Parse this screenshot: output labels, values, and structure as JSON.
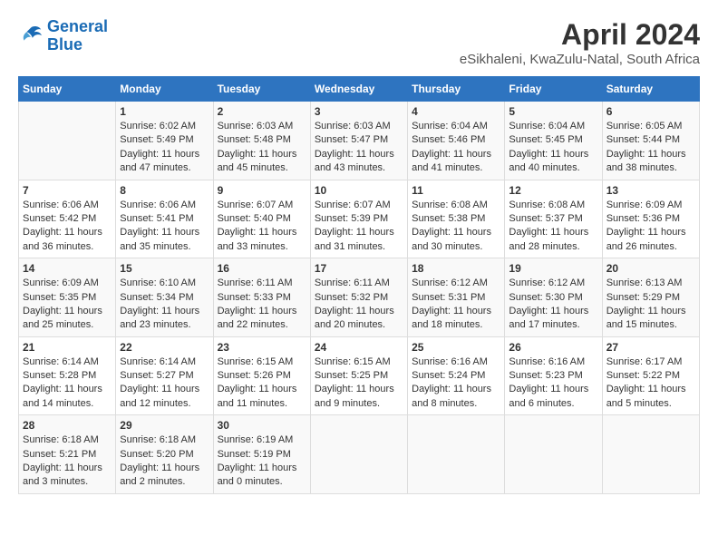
{
  "header": {
    "logo_line1": "General",
    "logo_line2": "Blue",
    "title": "April 2024",
    "subtitle": "eSikhaleni, KwaZulu-Natal, South Africa"
  },
  "columns": [
    "Sunday",
    "Monday",
    "Tuesday",
    "Wednesday",
    "Thursday",
    "Friday",
    "Saturday"
  ],
  "weeks": [
    [
      {
        "day": "",
        "lines": []
      },
      {
        "day": "1",
        "lines": [
          "Sunrise: 6:02 AM",
          "Sunset: 5:49 PM",
          "Daylight: 11 hours",
          "and 47 minutes."
        ]
      },
      {
        "day": "2",
        "lines": [
          "Sunrise: 6:03 AM",
          "Sunset: 5:48 PM",
          "Daylight: 11 hours",
          "and 45 minutes."
        ]
      },
      {
        "day": "3",
        "lines": [
          "Sunrise: 6:03 AM",
          "Sunset: 5:47 PM",
          "Daylight: 11 hours",
          "and 43 minutes."
        ]
      },
      {
        "day": "4",
        "lines": [
          "Sunrise: 6:04 AM",
          "Sunset: 5:46 PM",
          "Daylight: 11 hours",
          "and 41 minutes."
        ]
      },
      {
        "day": "5",
        "lines": [
          "Sunrise: 6:04 AM",
          "Sunset: 5:45 PM",
          "Daylight: 11 hours",
          "and 40 minutes."
        ]
      },
      {
        "day": "6",
        "lines": [
          "Sunrise: 6:05 AM",
          "Sunset: 5:44 PM",
          "Daylight: 11 hours",
          "and 38 minutes."
        ]
      }
    ],
    [
      {
        "day": "7",
        "lines": [
          "Sunrise: 6:06 AM",
          "Sunset: 5:42 PM",
          "Daylight: 11 hours",
          "and 36 minutes."
        ]
      },
      {
        "day": "8",
        "lines": [
          "Sunrise: 6:06 AM",
          "Sunset: 5:41 PM",
          "Daylight: 11 hours",
          "and 35 minutes."
        ]
      },
      {
        "day": "9",
        "lines": [
          "Sunrise: 6:07 AM",
          "Sunset: 5:40 PM",
          "Daylight: 11 hours",
          "and 33 minutes."
        ]
      },
      {
        "day": "10",
        "lines": [
          "Sunrise: 6:07 AM",
          "Sunset: 5:39 PM",
          "Daylight: 11 hours",
          "and 31 minutes."
        ]
      },
      {
        "day": "11",
        "lines": [
          "Sunrise: 6:08 AM",
          "Sunset: 5:38 PM",
          "Daylight: 11 hours",
          "and 30 minutes."
        ]
      },
      {
        "day": "12",
        "lines": [
          "Sunrise: 6:08 AM",
          "Sunset: 5:37 PM",
          "Daylight: 11 hours",
          "and 28 minutes."
        ]
      },
      {
        "day": "13",
        "lines": [
          "Sunrise: 6:09 AM",
          "Sunset: 5:36 PM",
          "Daylight: 11 hours",
          "and 26 minutes."
        ]
      }
    ],
    [
      {
        "day": "14",
        "lines": [
          "Sunrise: 6:09 AM",
          "Sunset: 5:35 PM",
          "Daylight: 11 hours",
          "and 25 minutes."
        ]
      },
      {
        "day": "15",
        "lines": [
          "Sunrise: 6:10 AM",
          "Sunset: 5:34 PM",
          "Daylight: 11 hours",
          "and 23 minutes."
        ]
      },
      {
        "day": "16",
        "lines": [
          "Sunrise: 6:11 AM",
          "Sunset: 5:33 PM",
          "Daylight: 11 hours",
          "and 22 minutes."
        ]
      },
      {
        "day": "17",
        "lines": [
          "Sunrise: 6:11 AM",
          "Sunset: 5:32 PM",
          "Daylight: 11 hours",
          "and 20 minutes."
        ]
      },
      {
        "day": "18",
        "lines": [
          "Sunrise: 6:12 AM",
          "Sunset: 5:31 PM",
          "Daylight: 11 hours",
          "and 18 minutes."
        ]
      },
      {
        "day": "19",
        "lines": [
          "Sunrise: 6:12 AM",
          "Sunset: 5:30 PM",
          "Daylight: 11 hours",
          "and 17 minutes."
        ]
      },
      {
        "day": "20",
        "lines": [
          "Sunrise: 6:13 AM",
          "Sunset: 5:29 PM",
          "Daylight: 11 hours",
          "and 15 minutes."
        ]
      }
    ],
    [
      {
        "day": "21",
        "lines": [
          "Sunrise: 6:14 AM",
          "Sunset: 5:28 PM",
          "Daylight: 11 hours",
          "and 14 minutes."
        ]
      },
      {
        "day": "22",
        "lines": [
          "Sunrise: 6:14 AM",
          "Sunset: 5:27 PM",
          "Daylight: 11 hours",
          "and 12 minutes."
        ]
      },
      {
        "day": "23",
        "lines": [
          "Sunrise: 6:15 AM",
          "Sunset: 5:26 PM",
          "Daylight: 11 hours",
          "and 11 minutes."
        ]
      },
      {
        "day": "24",
        "lines": [
          "Sunrise: 6:15 AM",
          "Sunset: 5:25 PM",
          "Daylight: 11 hours",
          "and 9 minutes."
        ]
      },
      {
        "day": "25",
        "lines": [
          "Sunrise: 6:16 AM",
          "Sunset: 5:24 PM",
          "Daylight: 11 hours",
          "and 8 minutes."
        ]
      },
      {
        "day": "26",
        "lines": [
          "Sunrise: 6:16 AM",
          "Sunset: 5:23 PM",
          "Daylight: 11 hours",
          "and 6 minutes."
        ]
      },
      {
        "day": "27",
        "lines": [
          "Sunrise: 6:17 AM",
          "Sunset: 5:22 PM",
          "Daylight: 11 hours",
          "and 5 minutes."
        ]
      }
    ],
    [
      {
        "day": "28",
        "lines": [
          "Sunrise: 6:18 AM",
          "Sunset: 5:21 PM",
          "Daylight: 11 hours",
          "and 3 minutes."
        ]
      },
      {
        "day": "29",
        "lines": [
          "Sunrise: 6:18 AM",
          "Sunset: 5:20 PM",
          "Daylight: 11 hours",
          "and 2 minutes."
        ]
      },
      {
        "day": "30",
        "lines": [
          "Sunrise: 6:19 AM",
          "Sunset: 5:19 PM",
          "Daylight: 11 hours",
          "and 0 minutes."
        ]
      },
      {
        "day": "",
        "lines": []
      },
      {
        "day": "",
        "lines": []
      },
      {
        "day": "",
        "lines": []
      },
      {
        "day": "",
        "lines": []
      }
    ]
  ]
}
